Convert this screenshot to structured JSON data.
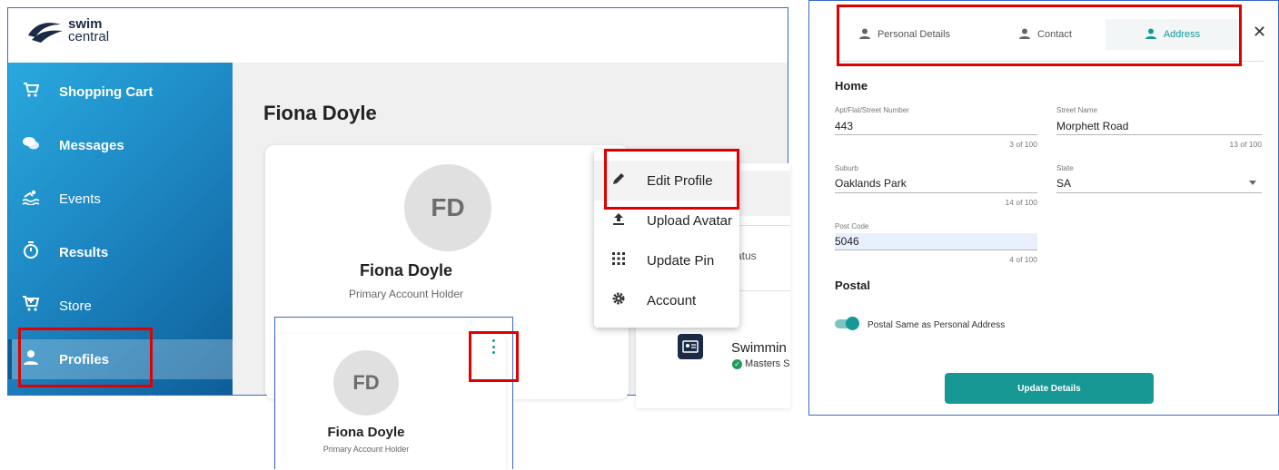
{
  "app": {
    "logo_line1": "swim",
    "logo_line2": "central"
  },
  "sidebar": {
    "items": [
      {
        "label": "Shopping Cart",
        "icon": "cart-icon"
      },
      {
        "label": "Messages",
        "icon": "chat-icon"
      },
      {
        "label": "Events",
        "icon": "pool-icon"
      },
      {
        "label": "Results",
        "icon": "stopwatch-icon"
      },
      {
        "label": "Store",
        "icon": "store-cart-icon"
      },
      {
        "label": "Profiles",
        "icon": "person-icon"
      }
    ],
    "active": "Profiles"
  },
  "profile_page": {
    "title": "Fiona Doyle",
    "card": {
      "initials": "FD",
      "name": "Fiona Doyle",
      "role": "Primary Account Holder"
    },
    "status_partial": "atus",
    "membership_partial": "Swimmin",
    "membership_sub_partial": "Masters S"
  },
  "context_menu": {
    "items": [
      {
        "label": "Edit Profile",
        "icon": "pencil-icon"
      },
      {
        "label": "Upload Avatar",
        "icon": "upload-icon"
      },
      {
        "label": "Update Pin",
        "icon": "keypad-icon"
      },
      {
        "label": "Account",
        "icon": "gear-icon"
      }
    ]
  },
  "inset": {
    "initials": "FD",
    "name": "Fiona Doyle",
    "role": "Primary Account Holder",
    "menu_icon": "kebab-menu-icon"
  },
  "edit_dialog": {
    "tabs": [
      {
        "label": "Personal Details",
        "icon": "person-icon"
      },
      {
        "label": "Contact",
        "icon": "person-icon"
      },
      {
        "label": "Address",
        "icon": "person-icon",
        "active": true
      }
    ],
    "close_icon": "close-icon",
    "home_heading": "Home",
    "fields": {
      "apt": {
        "label": "Apt/Flat/Street Number",
        "value": "443",
        "count": "3 of 100"
      },
      "street": {
        "label": "Street Name",
        "value": "Morphett Road",
        "count": "13 of 100"
      },
      "suburb": {
        "label": "Suburb",
        "value": "Oaklands Park",
        "count": "14 of 100"
      },
      "state": {
        "label": "State",
        "value": "SA"
      },
      "postcode": {
        "label": "Post Code",
        "value": "5046",
        "count": "4 of 100"
      }
    },
    "postal_heading": "Postal",
    "postal_toggle_label": "Postal Same as Personal Address",
    "postal_toggle_on": true,
    "submit_label": "Update Details"
  },
  "colors": {
    "accent_teal": "#179895",
    "highlight_red": "#e10000",
    "sidebar_blue": "#1c84c0"
  }
}
